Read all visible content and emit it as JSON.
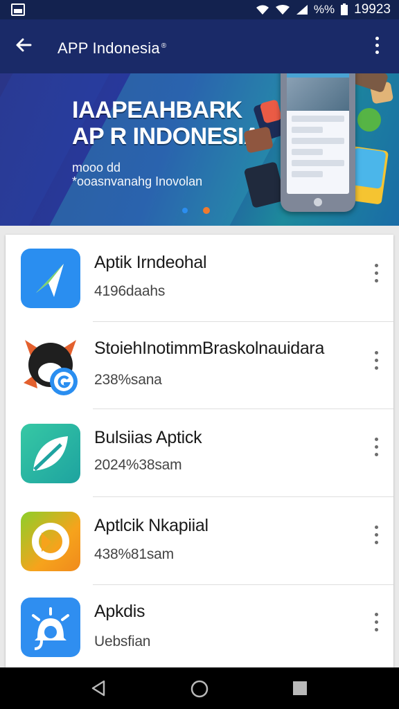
{
  "status": {
    "right_text": "%%",
    "time": "19923",
    "battery_icon": "battery-icon",
    "wifi_icon": "wifi-icon",
    "signal_icon": "signal-icon"
  },
  "appbar": {
    "title": "APP Indonesia",
    "title_mark": "®",
    "back_icon": "arrow-left-icon",
    "menu_icon": "more-vert-icon"
  },
  "hero": {
    "heading_1": "IAAPEAHBARK",
    "heading_2": "AP R INDONESIAI",
    "sub_1": "mooo dd",
    "sub_2": "*ooasnvanahg Inovolan"
  },
  "apps": [
    {
      "name": "Aptik Irndeohal",
      "meta": "4196daahs",
      "accent": "#2a8ef0"
    },
    {
      "name": "StoiehInotimmBraskolnauidara",
      "meta": "238%sana",
      "accent": "#e3602e"
    },
    {
      "name": "Bulsiias Aptick",
      "meta": "2024%38sam",
      "accent": "#2fb39b"
    },
    {
      "name": "Aptlcik Nkapiial",
      "meta": "438%81sam",
      "accent": "#f6a31c"
    },
    {
      "name": "Apkdis",
      "meta": "Uebsfian",
      "accent": "#2f8ef0"
    }
  ],
  "navbar": {
    "back_icon": "nav-back-icon",
    "home_icon": "nav-home-icon",
    "recents_icon": "nav-recents-icon"
  }
}
